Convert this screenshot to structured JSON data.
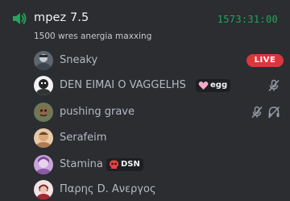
{
  "channel": {
    "name": "mpez 7.5",
    "timer": "1573:31:00",
    "status": "1500 wres anergia maxxing",
    "icon": "speaker-icon"
  },
  "members": [
    {
      "name": "Sneaky",
      "badge": "LIVE"
    },
    {
      "name": "DEN EIMAI O VAGGELHS",
      "tag": "egg",
      "tag_icon": "heart-icon",
      "state_icons": [
        "mic-muted-icon"
      ]
    },
    {
      "name": "pushing grave",
      "state_icons": [
        "mic-muted-icon",
        "headset-deafened-icon"
      ]
    },
    {
      "name": "Serafeim"
    },
    {
      "name": "Stamina",
      "tag": "DSN",
      "tag_icon": "skull-icon"
    },
    {
      "name": "Παρης D. Ανεργος"
    }
  ],
  "colors": {
    "background": "#2b2d31",
    "accent_green": "#23a55a",
    "live_red": "#da373c",
    "username": "#b5bac1"
  }
}
